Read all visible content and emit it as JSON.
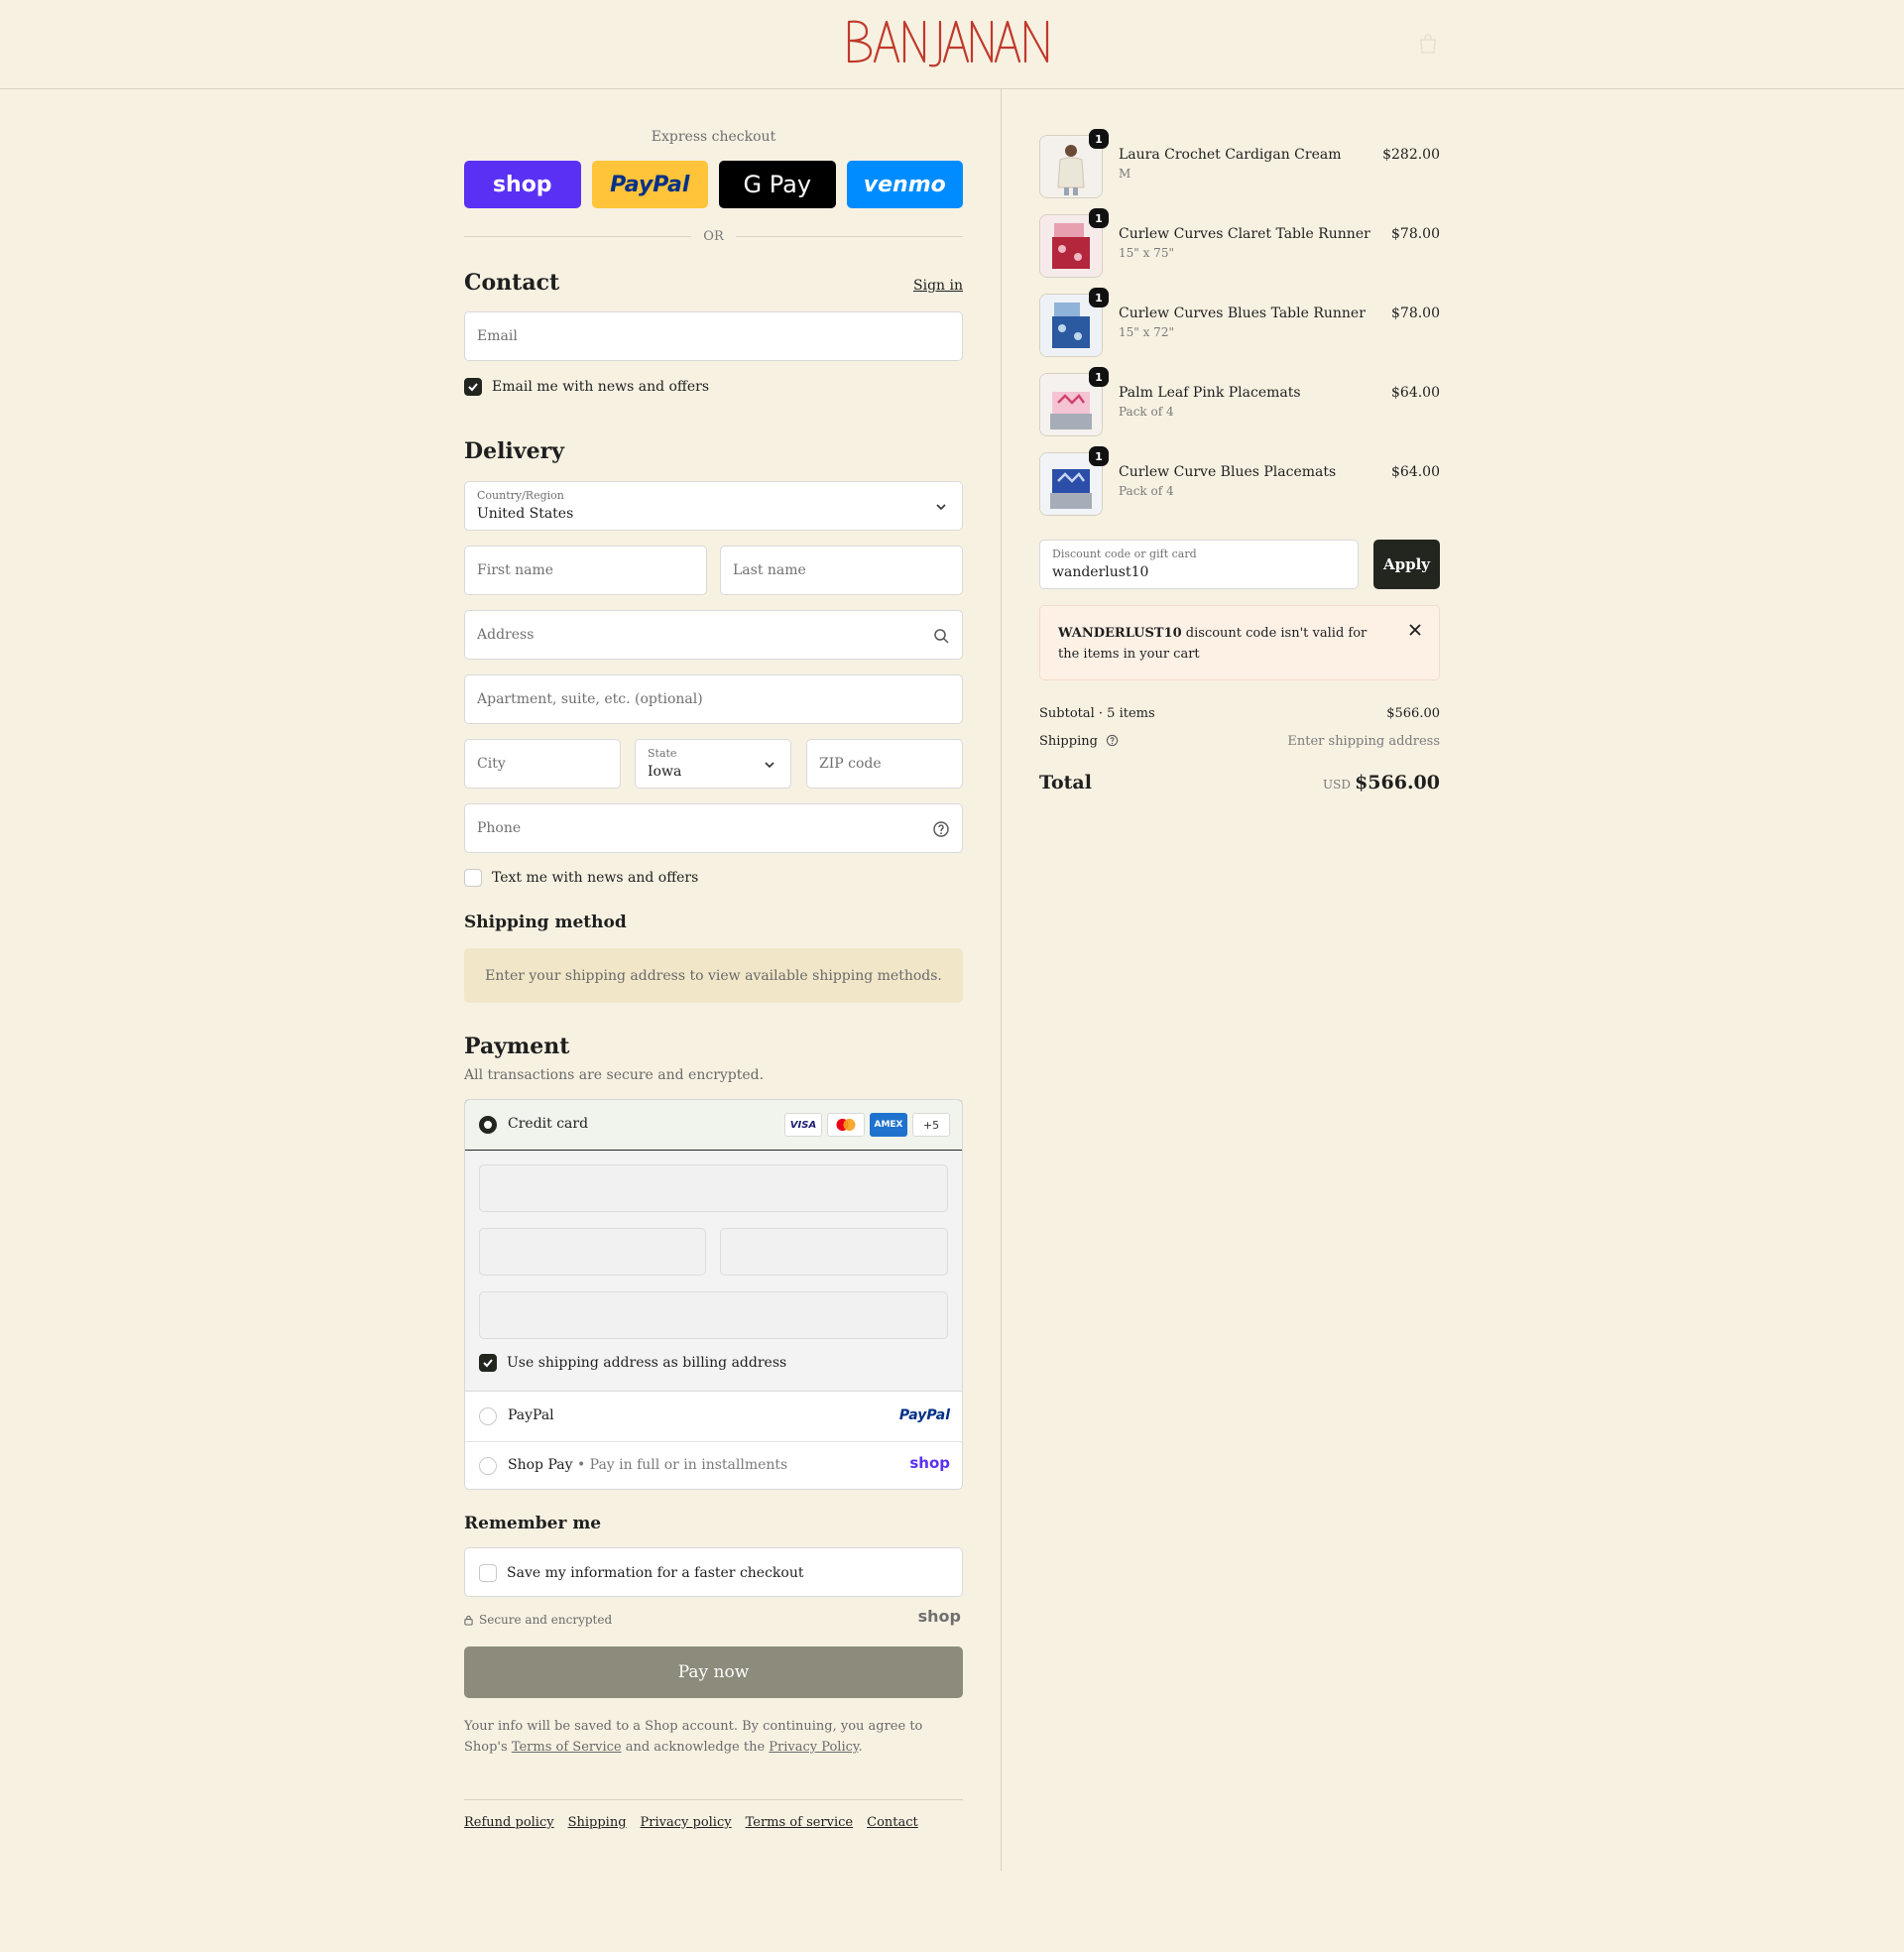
{
  "brand": {
    "name": "BANJANAN",
    "accent": "#c0392b"
  },
  "header": {
    "cart_icon": "bag-icon"
  },
  "express": {
    "title": "Express checkout",
    "buttons": [
      {
        "label": "shop",
        "color": "#5a31f4"
      },
      {
        "label": "PayPal",
        "color": "#ffc439"
      },
      {
        "label": "G Pay",
        "color": "#000000"
      },
      {
        "label": "venmo",
        "color": "#008cff"
      }
    ],
    "or": "OR"
  },
  "contact": {
    "title": "Contact",
    "sign_in": "Sign in",
    "email_placeholder": "Email",
    "news_label": "Email me with news and offers",
    "news_checked": true
  },
  "delivery": {
    "title": "Delivery",
    "country_label": "Country/Region",
    "country_value": "United States",
    "first_name": "First name",
    "last_name": "Last name",
    "address": "Address",
    "apartment": "Apartment, suite, etc. (optional)",
    "city": "City",
    "state_label": "State",
    "state_value": "Iowa",
    "zip": "ZIP code",
    "phone": "Phone",
    "text_label": "Text me with news and offers",
    "text_checked": false
  },
  "shipping_method": {
    "title": "Shipping method",
    "message": "Enter your shipping address to view available shipping methods."
  },
  "payment": {
    "title": "Payment",
    "note": "All transactions are secure and encrypted.",
    "credit_card": "Credit card",
    "cards": [
      "VISA",
      "MC",
      "AMEX",
      "+5"
    ],
    "billing_label": "Use shipping address as billing address",
    "billing_checked": true,
    "paypal": "PayPal",
    "paypal_brand": "PayPal",
    "shop_pay": "Shop Pay",
    "shop_pay_note": "• Pay in full or in installments",
    "shop_brand": "shop"
  },
  "remember": {
    "title": "Remember me",
    "label": "Save my information for a faster checkout",
    "secure": "Secure and encrypted",
    "shop_brand": "shop"
  },
  "pay_now": "Pay now",
  "legal": {
    "text1": "Your info will be saved to a Shop account. By continuing, you agree to Shop's ",
    "tos": "Terms of Service",
    "text2": " and acknowledge the ",
    "privacy": "Privacy Policy",
    "text3": "."
  },
  "footer": [
    "Refund policy",
    "Shipping",
    "Privacy policy",
    "Terms of service",
    "Contact"
  ],
  "order": {
    "items": [
      {
        "name": "Laura Crochet Cardigan Cream",
        "variant": "M",
        "price": "$282.00",
        "qty": "1"
      },
      {
        "name": "Curlew Curves Claret Table Runner",
        "variant": "15\" x 75\"",
        "price": "$78.00",
        "qty": "1"
      },
      {
        "name": "Curlew Curves Blues Table Runner",
        "variant": "15\" x 72\"",
        "price": "$78.00",
        "qty": "1"
      },
      {
        "name": "Palm Leaf Pink Placemats",
        "variant": "Pack of 4",
        "price": "$64.00",
        "qty": "1"
      },
      {
        "name": "Curlew Curve Blues Placemats",
        "variant": "Pack of 4",
        "price": "$64.00",
        "qty": "1"
      }
    ],
    "discount_label": "Discount code or gift card",
    "discount_value": "wanderlust10",
    "apply": "Apply",
    "error_code": "WANDERLUST10",
    "error_text": " discount code isn't valid for the items in your cart",
    "subtotal_label": "Subtotal · 5 items",
    "subtotal_value": "$566.00",
    "shipping_label": "Shipping",
    "shipping_value": "Enter shipping address",
    "total_label": "Total",
    "currency": "USD",
    "total_value": "$566.00"
  }
}
